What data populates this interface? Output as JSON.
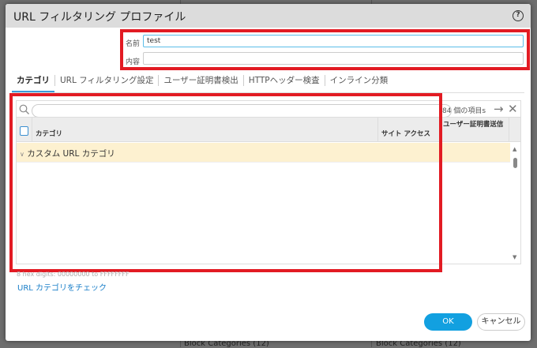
{
  "background": {
    "labels": [
      "Block Categories (12)",
      "Block Categories (12)"
    ]
  },
  "dialog": {
    "title": "URL フィルタリング プロファイル",
    "help_icon": "?"
  },
  "form": {
    "name_label": "名前",
    "name_value": "test",
    "description_label": "内容",
    "description_value": ""
  },
  "tabs": [
    {
      "label": "カテゴリ"
    },
    {
      "label": "URL フィルタリング設定"
    },
    {
      "label": "ユーザー証明書検出"
    },
    {
      "label": "HTTPヘッダー検査"
    },
    {
      "label": "インライン分類"
    }
  ],
  "grid": {
    "search_placeholder": "",
    "count": "84 個の項目s",
    "columns": [
      "カテゴリ",
      "サイト アクセス",
      "ユーザー証明書送信"
    ],
    "group_row": "カスタム URL カテゴリ"
  },
  "hint": "8 hex digits: 00000000 to FFFFFFFF",
  "link": "URL カテゴリをチェック",
  "buttons": {
    "ok": "OK",
    "cancel": "キャンセル"
  }
}
